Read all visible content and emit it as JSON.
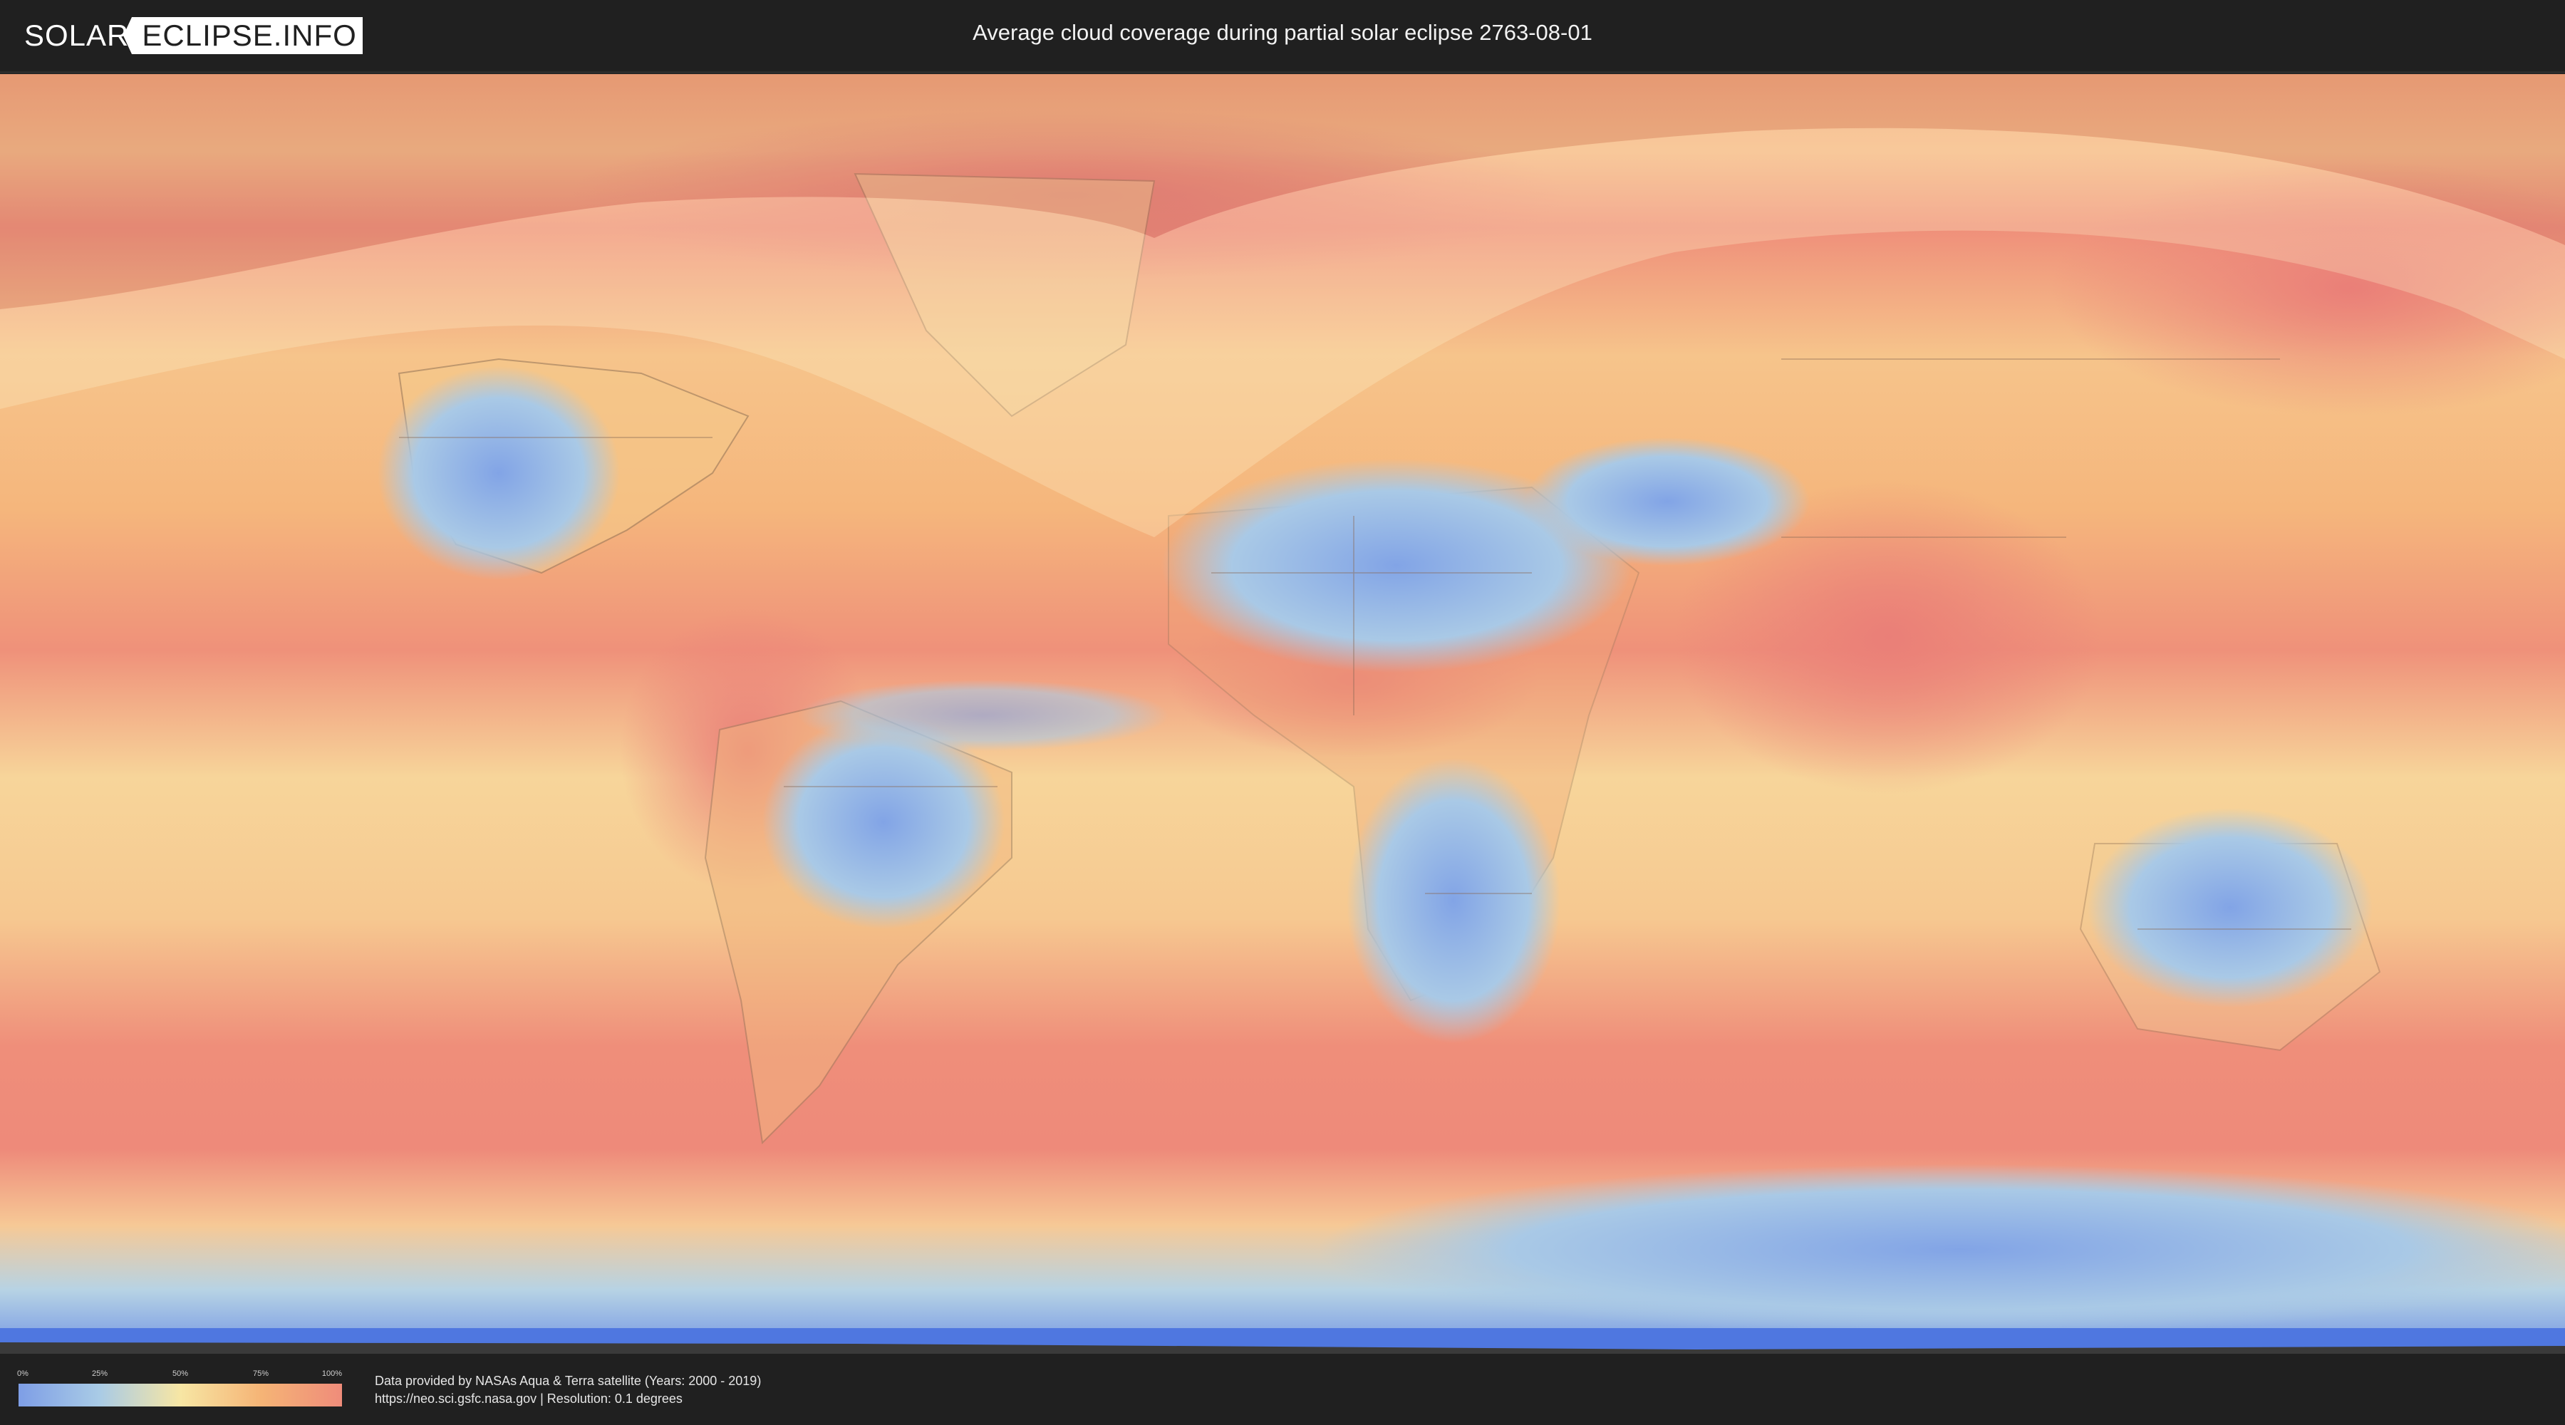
{
  "header": {
    "logo_part1": "SOLAR",
    "logo_part2": "ECLIPSE.INFO",
    "title": "Average cloud coverage during partial solar eclipse 2763-08-01"
  },
  "map": {
    "description_colors": {
      "clear": "#7e9ee6",
      "low": "#a9cbe6",
      "mid": "#f7e6a4",
      "high": "#f5b476",
      "overcast": "#ef8c7a"
    },
    "eclipse_zone_color": "#fff3c0"
  },
  "legend": {
    "ticks": [
      "0%",
      "25%",
      "50%",
      "75%",
      "100%"
    ],
    "colors": [
      "#7e9ee6",
      "#a9cbe6",
      "#f7e6a4",
      "#f5b476",
      "#ef8c7a"
    ]
  },
  "credits": {
    "line1": "Data provided by NASAs Aqua & Terra satellite (Years: 2000 - 2019)",
    "line2": "https://neo.sci.gsfc.nasa.gov | Resolution: 0.1 degrees"
  }
}
